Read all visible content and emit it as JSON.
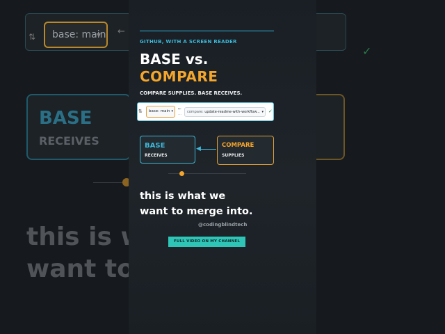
{
  "background": {
    "branch_label": "base: main",
    "card_title": "BASE",
    "card_subtitle": "RECEIVES",
    "big_caption_line1": "this is wh",
    "big_caption_line2": "want to m"
  },
  "panel": {
    "eyebrow": "GITHUB, WITH A SCREEN READER",
    "title_line1": "BASE vs.",
    "title_line2": "COMPARE",
    "subtitle": "COMPARE SUPPLIES. BASE RECEIVES.",
    "github_bar": {
      "base_branch": "base: main",
      "compare_label": "compare:",
      "compare_branch": "update-readme-with-workflow..."
    },
    "base_card": {
      "title": "BASE",
      "subtitle": "RECEIVES"
    },
    "compare_card": {
      "title": "COMPARE",
      "subtitle": "SUPPLIES"
    },
    "caption_line1": "this is what we",
    "caption_line2": "want to merge into.",
    "handle": "@codingblindtech",
    "cta": "FULL VIDEO ON MY CHANNEL"
  },
  "colors": {
    "accent_blue": "#3fb7d8",
    "accent_orange": "#f4a52b",
    "cta_teal": "#2ec4b6"
  },
  "icons": {
    "repo": "repo-icon",
    "arrow": "left-arrow-icon",
    "check": "check-icon",
    "caret": "caret-down-icon"
  }
}
